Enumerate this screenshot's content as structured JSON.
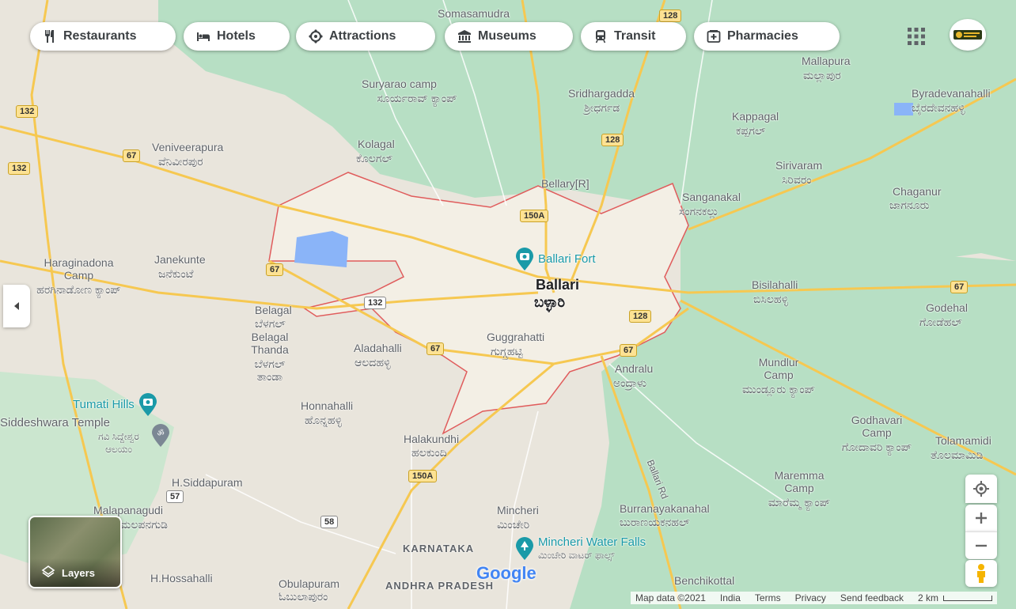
{
  "filters": [
    {
      "label": "Restaurants",
      "icon": "restaurant-icon"
    },
    {
      "label": "Hotels",
      "icon": "hotel-icon"
    },
    {
      "label": "Attractions",
      "icon": "attractions-icon"
    },
    {
      "label": "Museums",
      "icon": "museum-icon"
    },
    {
      "label": "Transit",
      "icon": "transit-icon"
    },
    {
      "label": "Pharmacies",
      "icon": "pharmacy-icon"
    }
  ],
  "city": {
    "name": "Ballari",
    "local": "ಬಳ್ಳಾರಿ"
  },
  "places": [
    {
      "en": "Somasamudra",
      "kn": ""
    },
    {
      "en": "Suryarao camp",
      "kn": "ಸೂರ್ಯರಾವ್ ಕ್ಯಾಂಪ್"
    },
    {
      "en": "Sridhargadda",
      "kn": "ಶ್ರೀಧರ್ಗಡ"
    },
    {
      "en": "Kappagal",
      "kn": "ಕಪ್ಪಗಲ್"
    },
    {
      "en": "Mallapura",
      "kn": "ಮಲ್ಲಾಪುರ"
    },
    {
      "en": "Byradevanahalli",
      "kn": "ಬೈರದೇವನಹಳ್ಳಿ"
    },
    {
      "en": "Veniveerapura",
      "kn": "ವೆನಿವೀರಪುರ"
    },
    {
      "en": "Kolagal",
      "kn": "ಕೊಲಗಲ್"
    },
    {
      "en": "Bellary[R]",
      "kn": ""
    },
    {
      "en": "Sirivaram",
      "kn": "ಸಿರಿವರಂ"
    },
    {
      "en": "Chaganur",
      "kn": "ಜಾಗನೂರು"
    },
    {
      "en": "Sanganakal",
      "kn": "ಸಂಗನಕಲ್ಲು"
    },
    {
      "en": "Haraginadona Camp",
      "kn": "ಹರಗಿನಾಡೋಣ ಕ್ಯಾಂಪ್"
    },
    {
      "en": "Janekunte",
      "kn": "ಜನೆಕುಂಟೆ"
    },
    {
      "en": "Bisilahalli",
      "kn": "ಬಿಸಿಲಹಳ್ಳಿ"
    },
    {
      "en": "Godehal",
      "kn": "ಗೋಡೆಹಲ್"
    },
    {
      "en": "Belagal",
      "kn": "ಬೆಳಗಲ್"
    },
    {
      "en": "Belagal Thanda",
      "kn": "ಬೆಳಗಲ್ ತಾಂಡಾ"
    },
    {
      "en": "Aladahalli",
      "kn": "ಆಲದಹಳ್ಳಿ"
    },
    {
      "en": "Guggrahatti",
      "kn": "ಗುಗ್ಗ್ರಹಟ್ಟಿ"
    },
    {
      "en": "Andralu",
      "kn": "ಅಂದ್ರಾಳು"
    },
    {
      "en": "Mundlur Camp",
      "kn": "ಮುಂಡ್ಲೂರು ಕ್ಯಾಂಪ್"
    },
    {
      "en": "Honnahalli",
      "kn": "ಹೊನ್ನಹಳ್ಳಿ"
    },
    {
      "en": "Halakundhi",
      "kn": "ಹಲಕುಂದಿ"
    },
    {
      "en": "Godhavari Camp",
      "kn": "ಗೋದಾವರಿ ಕ್ಯಾಂಪ್"
    },
    {
      "en": "Tolamamidi",
      "kn": "ತೊಲಮಾಮಿಡಿ"
    },
    {
      "en": "H.Siddapuram",
      "kn": ""
    },
    {
      "en": "Malapanagudi",
      "kn": "ಮಲಪನಗುಡಿ"
    },
    {
      "en": "Mincheri",
      "kn": "ಮಿಂಚೇರಿ"
    },
    {
      "en": "Burranayakanahal",
      "kn": "ಬುರಾಣಯಕನಹಲ್"
    },
    {
      "en": "Maremma Camp",
      "kn": "ಮಾರೆಮ್ಮ ಕ್ಯಾಂಪ್"
    },
    {
      "en": "H.Hossahalli",
      "kn": ""
    },
    {
      "en": "Obulapuram",
      "kn": "ಓಬುಲಾಪುರಂ"
    },
    {
      "en": "Benchikottal",
      "kn": ""
    }
  ],
  "pois": [
    {
      "name": "Ballari Fort"
    },
    {
      "name": "Tumati Hills"
    },
    {
      "name": "Siddeshwara Temple",
      "local": "ಗವಿ ಸಿದ್ದೇಶ್ವರ ಆಲಯಂ"
    },
    {
      "name": "Mincheri Water Falls",
      "local": "ಮಿಂಚೇರಿ ವಾಟರ್ ಫಾಲ್ಸ್"
    }
  ],
  "road_labels": [
    "128",
    "132",
    "67",
    "150A",
    "57",
    "58",
    "Ballari Rd"
  ],
  "regions": [
    "KARNATAKA",
    "ANDHRA PRADESH"
  ],
  "brand": "Google",
  "layers_label": "Layers",
  "footer": [
    "Map data ©2021",
    "India",
    "Terms",
    "Privacy",
    "Send feedback",
    "2 km"
  ],
  "colors": {
    "forest": "#b7dfc4",
    "land": "#e9e5dc",
    "city": "#f3efe5",
    "boundary": "#e05c5c",
    "highway": "#f6c851",
    "water": "#8ab4f8",
    "poi": "#1a9aa8"
  }
}
